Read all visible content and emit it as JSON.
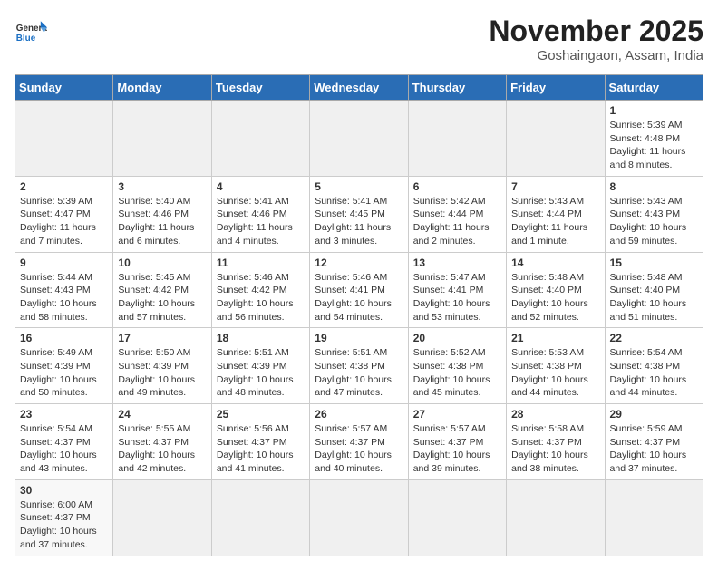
{
  "header": {
    "logo_general": "General",
    "logo_blue": "Blue",
    "month_title": "November 2025",
    "location": "Goshaingaon, Assam, India"
  },
  "weekdays": [
    "Sunday",
    "Monday",
    "Tuesday",
    "Wednesday",
    "Thursday",
    "Friday",
    "Saturday"
  ],
  "weeks": [
    [
      {
        "day": "",
        "info": "",
        "empty": true
      },
      {
        "day": "",
        "info": "",
        "empty": true
      },
      {
        "day": "",
        "info": "",
        "empty": true
      },
      {
        "day": "",
        "info": "",
        "empty": true
      },
      {
        "day": "",
        "info": "",
        "empty": true
      },
      {
        "day": "",
        "info": "",
        "empty": true
      },
      {
        "day": "1",
        "info": "Sunrise: 5:39 AM\nSunset: 4:48 PM\nDaylight: 11 hours\nand 8 minutes."
      }
    ],
    [
      {
        "day": "2",
        "info": "Sunrise: 5:39 AM\nSunset: 4:47 PM\nDaylight: 11 hours\nand 7 minutes."
      },
      {
        "day": "3",
        "info": "Sunrise: 5:40 AM\nSunset: 4:46 PM\nDaylight: 11 hours\nand 6 minutes."
      },
      {
        "day": "4",
        "info": "Sunrise: 5:41 AM\nSunset: 4:46 PM\nDaylight: 11 hours\nand 4 minutes."
      },
      {
        "day": "5",
        "info": "Sunrise: 5:41 AM\nSunset: 4:45 PM\nDaylight: 11 hours\nand 3 minutes."
      },
      {
        "day": "6",
        "info": "Sunrise: 5:42 AM\nSunset: 4:44 PM\nDaylight: 11 hours\nand 2 minutes."
      },
      {
        "day": "7",
        "info": "Sunrise: 5:43 AM\nSunset: 4:44 PM\nDaylight: 11 hours\nand 1 minute."
      },
      {
        "day": "8",
        "info": "Sunrise: 5:43 AM\nSunset: 4:43 PM\nDaylight: 10 hours\nand 59 minutes."
      }
    ],
    [
      {
        "day": "9",
        "info": "Sunrise: 5:44 AM\nSunset: 4:43 PM\nDaylight: 10 hours\nand 58 minutes."
      },
      {
        "day": "10",
        "info": "Sunrise: 5:45 AM\nSunset: 4:42 PM\nDaylight: 10 hours\nand 57 minutes."
      },
      {
        "day": "11",
        "info": "Sunrise: 5:46 AM\nSunset: 4:42 PM\nDaylight: 10 hours\nand 56 minutes."
      },
      {
        "day": "12",
        "info": "Sunrise: 5:46 AM\nSunset: 4:41 PM\nDaylight: 10 hours\nand 54 minutes."
      },
      {
        "day": "13",
        "info": "Sunrise: 5:47 AM\nSunset: 4:41 PM\nDaylight: 10 hours\nand 53 minutes."
      },
      {
        "day": "14",
        "info": "Sunrise: 5:48 AM\nSunset: 4:40 PM\nDaylight: 10 hours\nand 52 minutes."
      },
      {
        "day": "15",
        "info": "Sunrise: 5:48 AM\nSunset: 4:40 PM\nDaylight: 10 hours\nand 51 minutes."
      }
    ],
    [
      {
        "day": "16",
        "info": "Sunrise: 5:49 AM\nSunset: 4:39 PM\nDaylight: 10 hours\nand 50 minutes."
      },
      {
        "day": "17",
        "info": "Sunrise: 5:50 AM\nSunset: 4:39 PM\nDaylight: 10 hours\nand 49 minutes."
      },
      {
        "day": "18",
        "info": "Sunrise: 5:51 AM\nSunset: 4:39 PM\nDaylight: 10 hours\nand 48 minutes."
      },
      {
        "day": "19",
        "info": "Sunrise: 5:51 AM\nSunset: 4:38 PM\nDaylight: 10 hours\nand 47 minutes."
      },
      {
        "day": "20",
        "info": "Sunrise: 5:52 AM\nSunset: 4:38 PM\nDaylight: 10 hours\nand 45 minutes."
      },
      {
        "day": "21",
        "info": "Sunrise: 5:53 AM\nSunset: 4:38 PM\nDaylight: 10 hours\nand 44 minutes."
      },
      {
        "day": "22",
        "info": "Sunrise: 5:54 AM\nSunset: 4:38 PM\nDaylight: 10 hours\nand 44 minutes."
      }
    ],
    [
      {
        "day": "23",
        "info": "Sunrise: 5:54 AM\nSunset: 4:37 PM\nDaylight: 10 hours\nand 43 minutes."
      },
      {
        "day": "24",
        "info": "Sunrise: 5:55 AM\nSunset: 4:37 PM\nDaylight: 10 hours\nand 42 minutes."
      },
      {
        "day": "25",
        "info": "Sunrise: 5:56 AM\nSunset: 4:37 PM\nDaylight: 10 hours\nand 41 minutes."
      },
      {
        "day": "26",
        "info": "Sunrise: 5:57 AM\nSunset: 4:37 PM\nDaylight: 10 hours\nand 40 minutes."
      },
      {
        "day": "27",
        "info": "Sunrise: 5:57 AM\nSunset: 4:37 PM\nDaylight: 10 hours\nand 39 minutes."
      },
      {
        "day": "28",
        "info": "Sunrise: 5:58 AM\nSunset: 4:37 PM\nDaylight: 10 hours\nand 38 minutes."
      },
      {
        "day": "29",
        "info": "Sunrise: 5:59 AM\nSunset: 4:37 PM\nDaylight: 10 hours\nand 37 minutes."
      }
    ],
    [
      {
        "day": "30",
        "info": "Sunrise: 6:00 AM\nSunset: 4:37 PM\nDaylight: 10 hours\nand 37 minutes.",
        "last": true
      },
      {
        "day": "",
        "info": "",
        "empty": true
      },
      {
        "day": "",
        "info": "",
        "empty": true
      },
      {
        "day": "",
        "info": "",
        "empty": true
      },
      {
        "day": "",
        "info": "",
        "empty": true
      },
      {
        "day": "",
        "info": "",
        "empty": true
      },
      {
        "day": "",
        "info": "",
        "empty": true
      }
    ]
  ]
}
